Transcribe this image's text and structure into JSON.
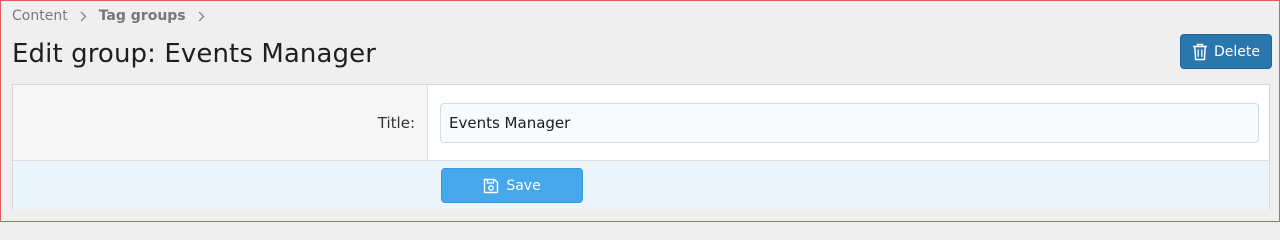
{
  "breadcrumb": {
    "items": [
      "Content",
      "Tag groups"
    ]
  },
  "page": {
    "title": "Edit group: Events Manager"
  },
  "header": {
    "delete_label": "Delete"
  },
  "form": {
    "title_label": "Title:",
    "title_value": "Events Manager",
    "save_label": "Save"
  },
  "icons": {
    "breadcrumb_separator": "chevron-right-icon",
    "delete": "trash-icon",
    "save": "floppy-disk-icon"
  },
  "colors": {
    "delete_button": "#2a77ad",
    "save_button": "#47a7eb",
    "submit_row_background": "#edf5fc",
    "page_background": "#efefef"
  }
}
